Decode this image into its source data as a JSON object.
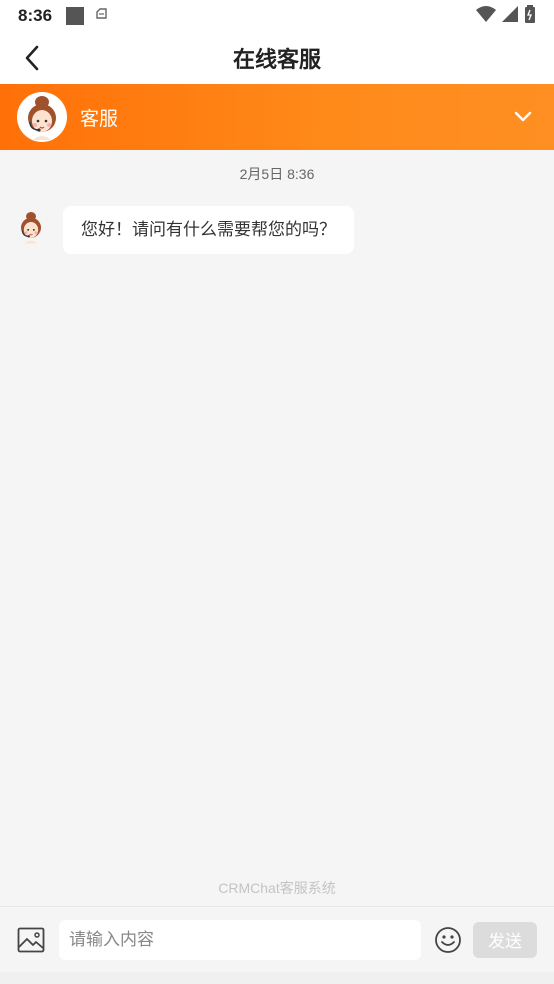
{
  "status_bar": {
    "time": "8:36",
    "icons": [
      "square-icon",
      "notification-icon",
      "wifi-icon",
      "signal-icon",
      "battery-icon"
    ]
  },
  "header": {
    "title": "在线客服",
    "back_icon": "chevron-left-icon"
  },
  "agent": {
    "name": "客服",
    "avatar_icon": "agent-avatar-icon",
    "toggle_icon": "chevron-down-icon"
  },
  "chat": {
    "timestamp": "2月5日 8:36",
    "messages": [
      {
        "sender": "agent",
        "text": "您好！请问有什么需要帮您的吗？"
      }
    ],
    "footer_brand": "CRMChat客服系统"
  },
  "input_bar": {
    "image_icon": "image-icon",
    "placeholder": "请输入内容",
    "value": "",
    "emoji_icon": "emoji-icon",
    "send_label": "发送"
  },
  "colors": {
    "accent": "#ff7a10",
    "background": "#f5f5f5",
    "send_disabled": "#dcdcdc"
  }
}
